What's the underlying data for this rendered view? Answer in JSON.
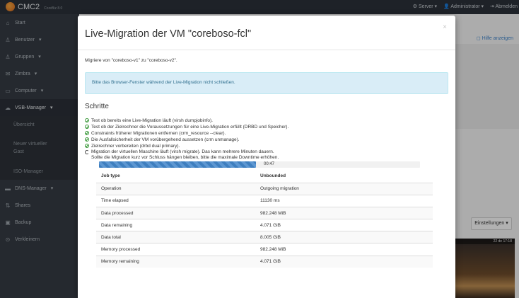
{
  "navbar": {
    "brand": "CMC2",
    "version": "CoreBiz 8.0",
    "items": [
      "Server",
      "Administrator",
      "Abmelden"
    ]
  },
  "sidebar": {
    "items": [
      {
        "label": "Start",
        "icon": "home-icon"
      },
      {
        "label": "Benutzer",
        "icon": "user-icon"
      },
      {
        "label": "Gruppen",
        "icon": "users-icon"
      },
      {
        "label": "Zimbra",
        "icon": "mail-icon"
      },
      {
        "label": "Computer",
        "icon": "monitor-icon"
      },
      {
        "label": "VSB-Manager",
        "icon": "cloud-icon"
      }
    ],
    "subitems": [
      "Übersicht",
      "Neuer virtueller Gast",
      "ISO-Manager"
    ],
    "items_after": [
      {
        "label": "DNS-Manager",
        "icon": "hdd-icon"
      },
      {
        "label": "Shares",
        "icon": "share-icon"
      },
      {
        "label": "Backup",
        "icon": "backup-icon"
      },
      {
        "label": "Verkleinern",
        "icon": "collapse-icon"
      }
    ]
  },
  "background": {
    "help_label": "Hilfe anzeigen",
    "settings_label": "Einstellungen",
    "thumb_caption": "22 de 17:18"
  },
  "modal": {
    "title": "Live-Migration der VM \"coreboso-fcl\"",
    "close": "×",
    "intro": "Migriere von \"coreboso-v1\" zu \"coreboso-v2\".",
    "alert": "Bitte das Browser-Fenster während der Live-Migration nicht schließen.",
    "steps_title": "Schritte",
    "steps": [
      {
        "text": "Test ob bereits eine Live-Migration läuft (virsh dumpjobinfo).",
        "state": "done"
      },
      {
        "text": "Test ob der Zielrechner die Voraussetzungen für eine Live-Migration erfüllt (DRBD und Speicher).",
        "state": "done"
      },
      {
        "text": "Constraints früherer Migrationen entfernen (crm_resource --clear).",
        "state": "done"
      },
      {
        "text": "Die Ausfallsicherheit der VM vorübergehend aussetzen (crm unmanage).",
        "state": "done"
      },
      {
        "text": "Zielrechner vorbereiten (drbd dual primary).",
        "state": "done"
      },
      {
        "text": "Migration der virtuellen Maschine läuft (virsh migrate). Das kann mehrere Minuten dauern.",
        "state": "running"
      }
    ],
    "step_note": "Sollte die Migration kurz vor Schluss hängen bleiben, bitte die maximale Downtime erhöhen.",
    "progress": {
      "fraction": 0.49,
      "label": "00:47"
    },
    "table": {
      "headers": [
        "Job type",
        "Unbounded"
      ],
      "rows": [
        [
          "Operation",
          "Outgoing migration"
        ],
        [
          "Time elapsed",
          "11130 ms"
        ],
        [
          "Data processed",
          "982.248 MiB"
        ],
        [
          "Data remaining",
          "4.071 GiB"
        ],
        [
          "Data total",
          "8.005 GiB"
        ],
        [
          "Memory processed",
          "982.248 MiB"
        ],
        [
          "Memory remaining",
          "4.071 GiB"
        ]
      ]
    }
  }
}
